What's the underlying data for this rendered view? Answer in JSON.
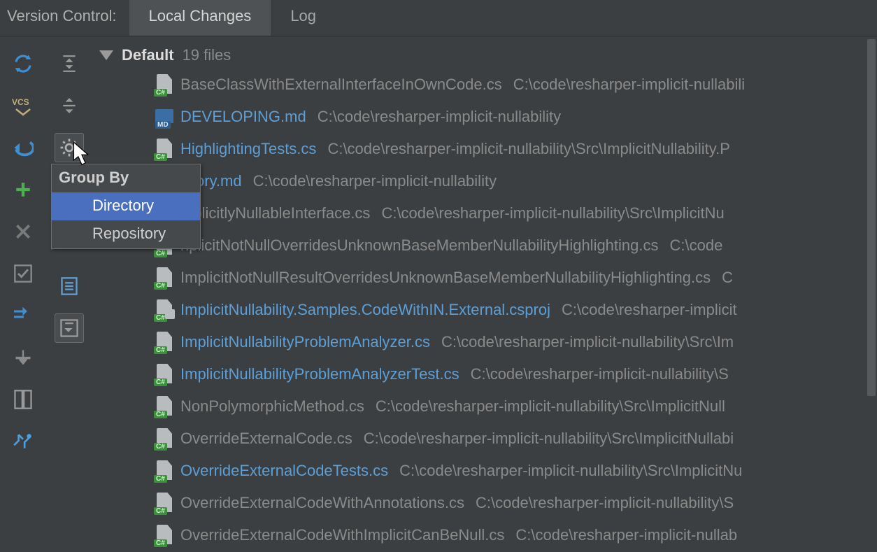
{
  "header": {
    "panel_label": "Version Control:",
    "tabs": [
      {
        "label": "Local Changes",
        "active": true
      },
      {
        "label": "Log",
        "active": false
      }
    ]
  },
  "toolbar_left": [
    {
      "name": "refresh-icon"
    },
    {
      "name": "vcs-commit-icon"
    },
    {
      "name": "rollback-icon"
    },
    {
      "name": "add-icon"
    },
    {
      "name": "delete-icon"
    },
    {
      "name": "toggle-checkbox-icon"
    },
    {
      "name": "move-to-changelist-icon"
    },
    {
      "name": "shelve-icon"
    },
    {
      "name": "diff-icon"
    },
    {
      "name": "refresh-vcs-icon"
    }
  ],
  "toolbar_right": [
    {
      "name": "expand-all-icon"
    },
    {
      "name": "collapse-all-icon"
    },
    {
      "name": "settings-gear-icon",
      "active": true
    },
    {
      "name": "details-icon"
    },
    {
      "name": "preview-diff-icon"
    }
  ],
  "popup": {
    "title": "Group By",
    "items": [
      {
        "label": "Directory",
        "selected": true
      },
      {
        "label": "Repository",
        "selected": false
      }
    ]
  },
  "changelist": {
    "name": "Default",
    "count_label": "19 files",
    "files": [
      {
        "icon": "cs",
        "color": "gray",
        "name": "BaseClassWithExternalInterfaceInOwnCode.cs",
        "path": "C:\\code\\resharper-implicit-nullabili"
      },
      {
        "icon": "md",
        "color": "blue",
        "name": "DEVELOPING.md",
        "path": "C:\\code\\resharper-implicit-nullability"
      },
      {
        "icon": "cs",
        "color": "blue",
        "name": "HighlightingTests.cs",
        "path": "C:\\code\\resharper-implicit-nullability\\Src\\ImplicitNullability.P"
      },
      {
        "icon": "md",
        "color": "blue",
        "name": "istory.md",
        "path": "C:\\code\\resharper-implicit-nullability"
      },
      {
        "icon": "cs",
        "color": "gray",
        "name": "mplicitlyNullableInterface.cs",
        "path": "C:\\code\\resharper-implicit-nullability\\Src\\ImplicitNu"
      },
      {
        "icon": "cs",
        "color": "gray",
        "name": "nplicitNotNullOverridesUnknownBaseMemberNullabilityHighlighting.cs",
        "path": "C:\\code"
      },
      {
        "icon": "cs",
        "color": "gray",
        "name": "ImplicitNotNullResultOverridesUnknownBaseMemberNullabilityHighlighting.cs",
        "path": "C"
      },
      {
        "icon": "proj",
        "color": "blue",
        "name": "ImplicitNullability.Samples.CodeWithIN.External.csproj",
        "path": "C:\\code\\resharper-implicit"
      },
      {
        "icon": "cs",
        "color": "blue",
        "name": "ImplicitNullabilityProblemAnalyzer.cs",
        "path": "C:\\code\\resharper-implicit-nullability\\Src\\Im"
      },
      {
        "icon": "cs",
        "color": "blue",
        "name": "ImplicitNullabilityProblemAnalyzerTest.cs",
        "path": "C:\\code\\resharper-implicit-nullability\\S"
      },
      {
        "icon": "cs",
        "color": "gray",
        "name": "NonPolymorphicMethod.cs",
        "path": "C:\\code\\resharper-implicit-nullability\\Src\\ImplicitNull"
      },
      {
        "icon": "cs",
        "color": "gray",
        "name": "OverrideExternalCode.cs",
        "path": "C:\\code\\resharper-implicit-nullability\\Src\\ImplicitNullabi"
      },
      {
        "icon": "cs",
        "color": "blue",
        "name": "OverrideExternalCodeTests.cs",
        "path": "C:\\code\\resharper-implicit-nullability\\Src\\ImplicitNu"
      },
      {
        "icon": "cs",
        "color": "gray",
        "name": "OverrideExternalCodeWithAnnotations.cs",
        "path": "C:\\code\\resharper-implicit-nullability\\S"
      },
      {
        "icon": "cs",
        "color": "gray",
        "name": "OverrideExternalCodeWithImplicitCanBeNull.cs",
        "path": "C:\\code\\resharper-implicit-nullab"
      }
    ]
  }
}
